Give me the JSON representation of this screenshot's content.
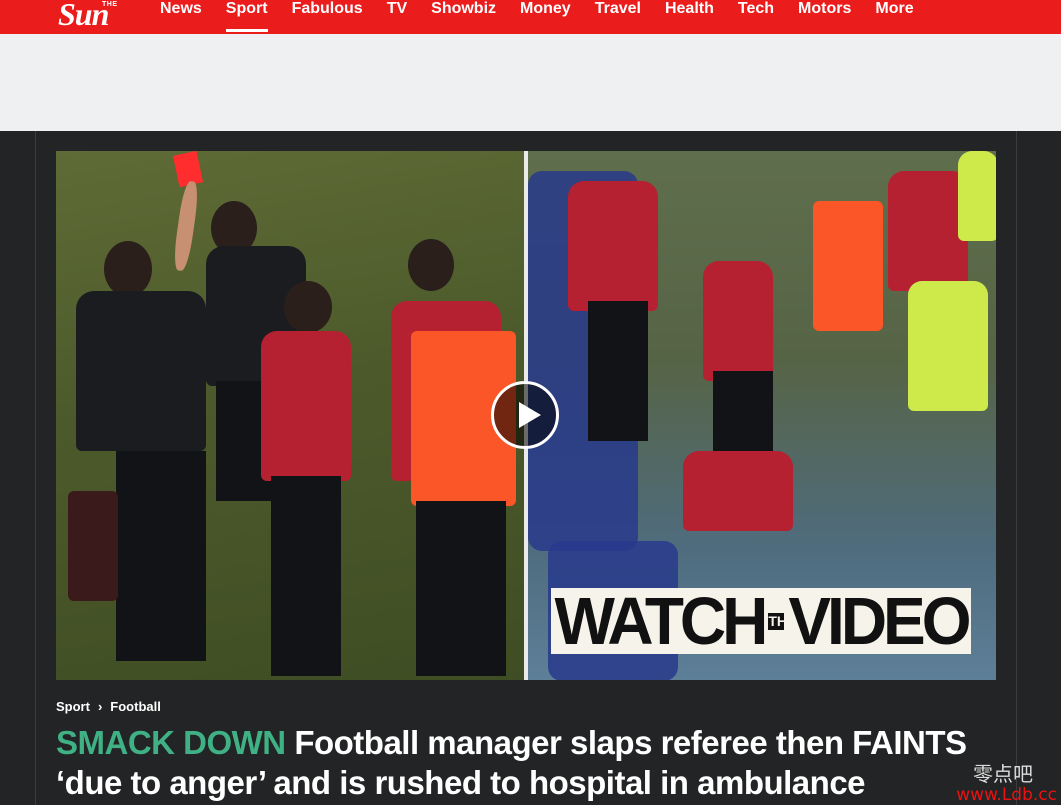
{
  "brand": {
    "the": "THE",
    "name": "Sun"
  },
  "nav": {
    "items": [
      {
        "label": "News"
      },
      {
        "label": "Sport",
        "active": true
      },
      {
        "label": "Fabulous"
      },
      {
        "label": "TV"
      },
      {
        "label": "Showbiz"
      },
      {
        "label": "Money"
      },
      {
        "label": "Travel"
      },
      {
        "label": "Health"
      },
      {
        "label": "Tech"
      },
      {
        "label": "Motors"
      },
      {
        "label": "More"
      }
    ]
  },
  "video": {
    "overlay_left": "WATCH",
    "overlay_the": "THE",
    "overlay_right": "VIDEO",
    "play_icon": "play-icon"
  },
  "breadcrumb": {
    "section": "Sport",
    "subsection": "Football"
  },
  "headline": {
    "kicker": "SMACK DOWN",
    "text": "Football manager slaps referee then FAINTS ‘due to anger’ and is rushed to hospital in ambulance"
  },
  "watermark": {
    "cn": "零点吧",
    "url": "www.Ldb.cc"
  },
  "colors": {
    "nav_red": "#eb1c1c",
    "kicker_green": "#3fb185",
    "article_bg": "#222425"
  }
}
